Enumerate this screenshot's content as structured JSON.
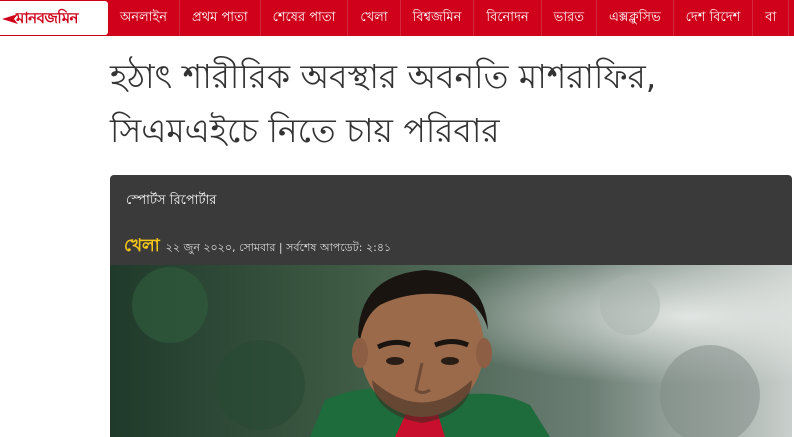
{
  "logo": {
    "text": "মানবজমিন"
  },
  "nav": {
    "items": [
      "অনলাইন",
      "প্রথম পাতা",
      "শেষের পাতা",
      "খেলা",
      "বিশ্বজমিন",
      "বিনোদন",
      "ভারত",
      "এক্সক্লুসিভ",
      "দেশ বিদেশ",
      "বা"
    ]
  },
  "article": {
    "title_line1": "হঠাৎ শারীরিক অবস্থার অবনতি মাশরাফির,",
    "title_line2": "সিএমএইচে নিতে চায় পরিবার",
    "reporter": "স্পোর্টস রিপোর্টার",
    "category": "খেলা",
    "date": "২২ জুন ২০২০, সোমবার | সর্বশেষ আপডেট: ২:৪১"
  },
  "colors": {
    "brand_red": "#d0021b",
    "meta_bg": "#3a3a3a",
    "category_yellow": "#f5c518"
  }
}
